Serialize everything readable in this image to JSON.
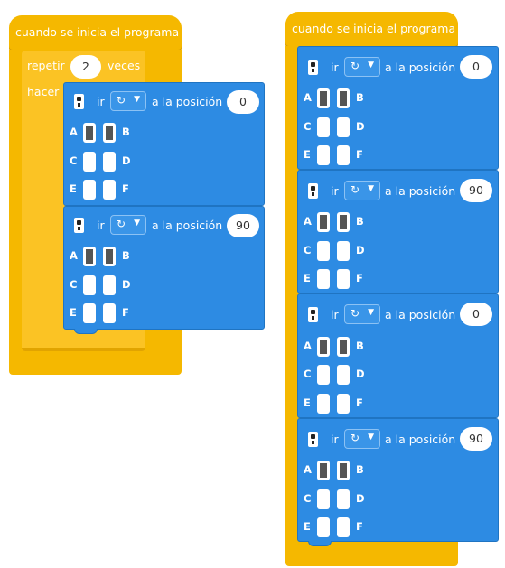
{
  "left": {
    "hat_label": "cuando se inicia el programa",
    "repeat_label": "repetir",
    "repeat_count": "2",
    "times_label": "veces",
    "do_label": "hacer",
    "blocks": [
      {
        "go": "ir",
        "to_label": "a la posición",
        "position": "0",
        "ports": [
          [
            "A",
            "B"
          ],
          [
            "C",
            "D"
          ],
          [
            "E",
            "F"
          ]
        ]
      },
      {
        "go": "ir",
        "to_label": "a la posición",
        "position": "90",
        "ports": [
          [
            "A",
            "B"
          ],
          [
            "C",
            "D"
          ],
          [
            "E",
            "F"
          ]
        ]
      }
    ]
  },
  "right": {
    "hat_label": "cuando se inicia el programa",
    "blocks": [
      {
        "go": "ir",
        "to_label": "a la posición",
        "position": "0",
        "ports": [
          [
            "A",
            "B"
          ],
          [
            "C",
            "D"
          ],
          [
            "E",
            "F"
          ]
        ]
      },
      {
        "go": "ir",
        "to_label": "a la posición",
        "position": "90",
        "ports": [
          [
            "A",
            "B"
          ],
          [
            "C",
            "D"
          ],
          [
            "E",
            "F"
          ]
        ]
      },
      {
        "go": "ir",
        "to_label": "a la posición",
        "position": "0",
        "ports": [
          [
            "A",
            "B"
          ],
          [
            "C",
            "D"
          ],
          [
            "E",
            "F"
          ]
        ]
      },
      {
        "go": "ir",
        "to_label": "a la posición",
        "position": "90",
        "ports": [
          [
            "A",
            "B"
          ],
          [
            "C",
            "D"
          ],
          [
            "E",
            "F"
          ]
        ]
      }
    ]
  },
  "icons": {
    "rotate": "↻",
    "caret": "▼",
    "servo": "servo-icon"
  },
  "colors": {
    "event": "#f5b800",
    "control": "#fbc324",
    "motion": "#2d8be3"
  }
}
